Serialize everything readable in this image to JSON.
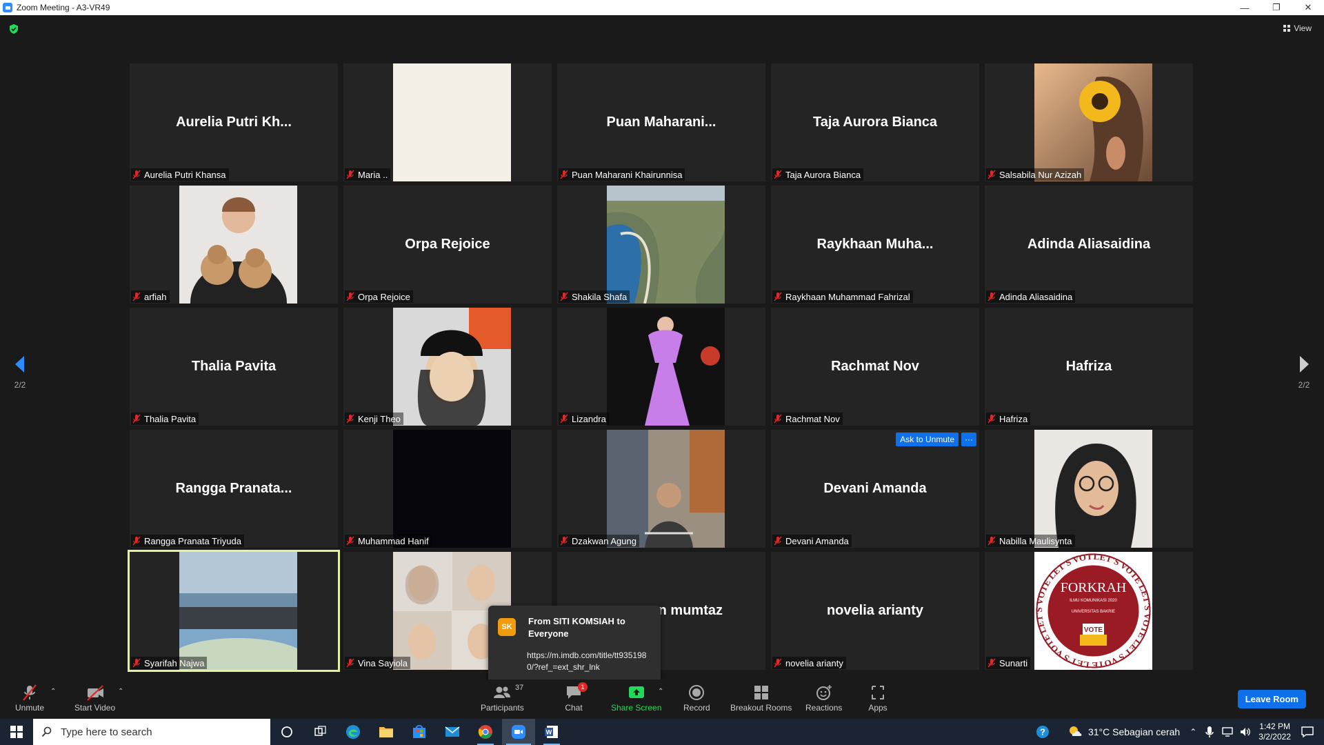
{
  "window": {
    "title": "Zoom Meeting - A3-VR49",
    "controls": [
      "—",
      "❐",
      "✕"
    ]
  },
  "header": {
    "view_label": "View"
  },
  "pager": {
    "left_page": "2/2",
    "right_page": "2/2"
  },
  "tiles": [
    {
      "name": "Aurelia Putri Khansa",
      "display": "Aurelia Putri Kh...",
      "photo": null
    },
    {
      "name": "Maria ..",
      "display": "",
      "photo": "cream"
    },
    {
      "name": "Puan Maharani Khairunnisa",
      "display": "Puan Maharani...",
      "photo": null
    },
    {
      "name": "Taja Aurora Bianca",
      "display": "Taja Aurora Bianca",
      "photo": null
    },
    {
      "name": "Salsabila Nur Azizah",
      "display": "",
      "photo": "sunflower"
    },
    {
      "name": "arfiah",
      "display": "",
      "photo": "bears"
    },
    {
      "name": "Orpa Rejoice",
      "display": "Orpa Rejoice",
      "photo": null
    },
    {
      "name": "Shakila Shafa",
      "display": "",
      "photo": "coast"
    },
    {
      "name": "Raykhaan Muhammad Fahrizal",
      "display": "Raykhaan Muha...",
      "photo": null
    },
    {
      "name": "Adinda Aliasaidina",
      "display": "Adinda Aliasaidina",
      "photo": null
    },
    {
      "name": "Thalia Pavita",
      "display": "Thalia Pavita",
      "photo": null
    },
    {
      "name": "Kenji Theo",
      "display": "",
      "photo": "cap"
    },
    {
      "name": "Lizandra",
      "display": "",
      "photo": "dress"
    },
    {
      "name": "Rachmat Nov",
      "display": "Rachmat Nov",
      "photo": null
    },
    {
      "name": "Hafriza",
      "display": "Hafriza",
      "photo": null
    },
    {
      "name": "Rangga Pranata Triyuda",
      "display": "Rangga Pranata...",
      "photo": null
    },
    {
      "name": "Muhammad Hanif",
      "display": "",
      "photo": "black"
    },
    {
      "name": "Dzakwan Agung",
      "display": "",
      "photo": "street"
    },
    {
      "name": "Devani Amanda",
      "display": "Devani Amanda",
      "photo": null,
      "ask_unmute": "Ask to Unmute",
      "more": "···"
    },
    {
      "name": "Nabilla Maulisynta",
      "display": "",
      "photo": "hijab"
    },
    {
      "name": "Syarifah Najwa",
      "display": "",
      "photo": "sea",
      "active": true
    },
    {
      "name": "Vina Sayiola",
      "display": "",
      "photo": "collage"
    },
    {
      "name": "",
      "display": "n mumtaz",
      "photo": null
    },
    {
      "name": "novelia arianty",
      "display": "novelia arianty",
      "photo": null
    },
    {
      "name": "Sunarti",
      "display": "",
      "photo": "forkrah"
    }
  ],
  "forkrah_logo": {
    "title": "FORKRAH",
    "sub1": "ILMU KOMUNIKASI 2020",
    "sub2": "UNIVERSITAS BAKRIE",
    "vote": "VOTE",
    "ring": "LET'S VOTE LET'S VOTE LET'S VOTE"
  },
  "chat_toast": {
    "avatar": "SK",
    "from": "From SITI KOMSIAH to Everyone",
    "message": "https://m.imdb.com/title/tt9351980/?ref_=ext_shr_lnk"
  },
  "toolbar": {
    "unmute": "Unmute",
    "start_video": "Start Video",
    "participants": "Participants",
    "participants_count": "37",
    "chat": "Chat",
    "chat_badge": "1",
    "share_screen": "Share Screen",
    "record": "Record",
    "breakout_rooms": "Breakout Rooms",
    "reactions": "Reactions",
    "apps": "Apps",
    "leave": "Leave Room"
  },
  "colors": {
    "accent": "#0e71eb",
    "share_green": "#23d959",
    "active_border": "#e3f29b",
    "toast_avatar": "#f29b0f"
  },
  "taskbar": {
    "search_placeholder": "Type here to search",
    "weather": "31°C  Sebagian cerah",
    "time": "1:42 PM",
    "date": "3/2/2022"
  }
}
